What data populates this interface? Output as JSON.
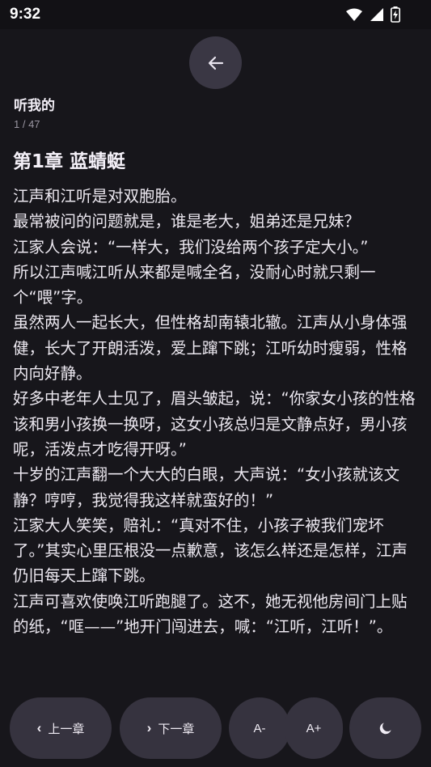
{
  "status_bar": {
    "time": "9:32",
    "icons": [
      "wifi-icon",
      "cell-signal-icon",
      "battery-charging-icon"
    ]
  },
  "header": {
    "back_icon": "arrow-left-icon",
    "book_title": "听我的",
    "page_counter": "1 / 47"
  },
  "chapter": {
    "title": "第1章 蓝蜻蜓",
    "paragraphs": [
      "江声和江听是对双胞胎。",
      "最常被问的问题就是，谁是老大，姐弟还是兄妹？",
      "江家人会说：“一样大，我们没给两个孩子定大小。”",
      "所以江声喊江听从来都是喊全名，没耐心时就只剩一个“喂”字。",
      "虽然两人一起长大，但性格却南辕北辙。江声从小身体强健，长大了开朗活泼，爱上蹿下跳；江听幼时瘦弱，性格内向好静。",
      "好多中老年人士见了，眉头皱起，说：“你家女小孩的性格该和男小孩换一换呀，这女小孩总归是文静点好，男小孩呢，活泼点才吃得开呀。”",
      "十岁的江声翻一个大大的白眼，大声说：“女小孩就该文静？哼哼，我觉得我这样就蛮好的！”",
      "江家大人笑笑，赔礼：“真对不住，小孩子被我们宠坏了。”其实心里压根没一点歉意，该怎么样还是怎样，江声仍旧每天上蹿下跳。",
      "江声可喜欢使唤江听跑腿了。这不，她无视他房间门上贴的纸，“哐——”地开门闯进去，喊：“江听，江听！”。"
    ]
  },
  "toolbar": {
    "prev_chapter": "上一章",
    "prev_icon": "chevron-left-icon",
    "next_chapter": "下一章",
    "next_icon": "chevron-right-icon",
    "font_decrease": "A-",
    "font_increase": "A+",
    "night_mode_icon": "moon-icon"
  },
  "colors": {
    "background": "#17161b",
    "button": "#36333f",
    "text": "#ece8f0"
  }
}
